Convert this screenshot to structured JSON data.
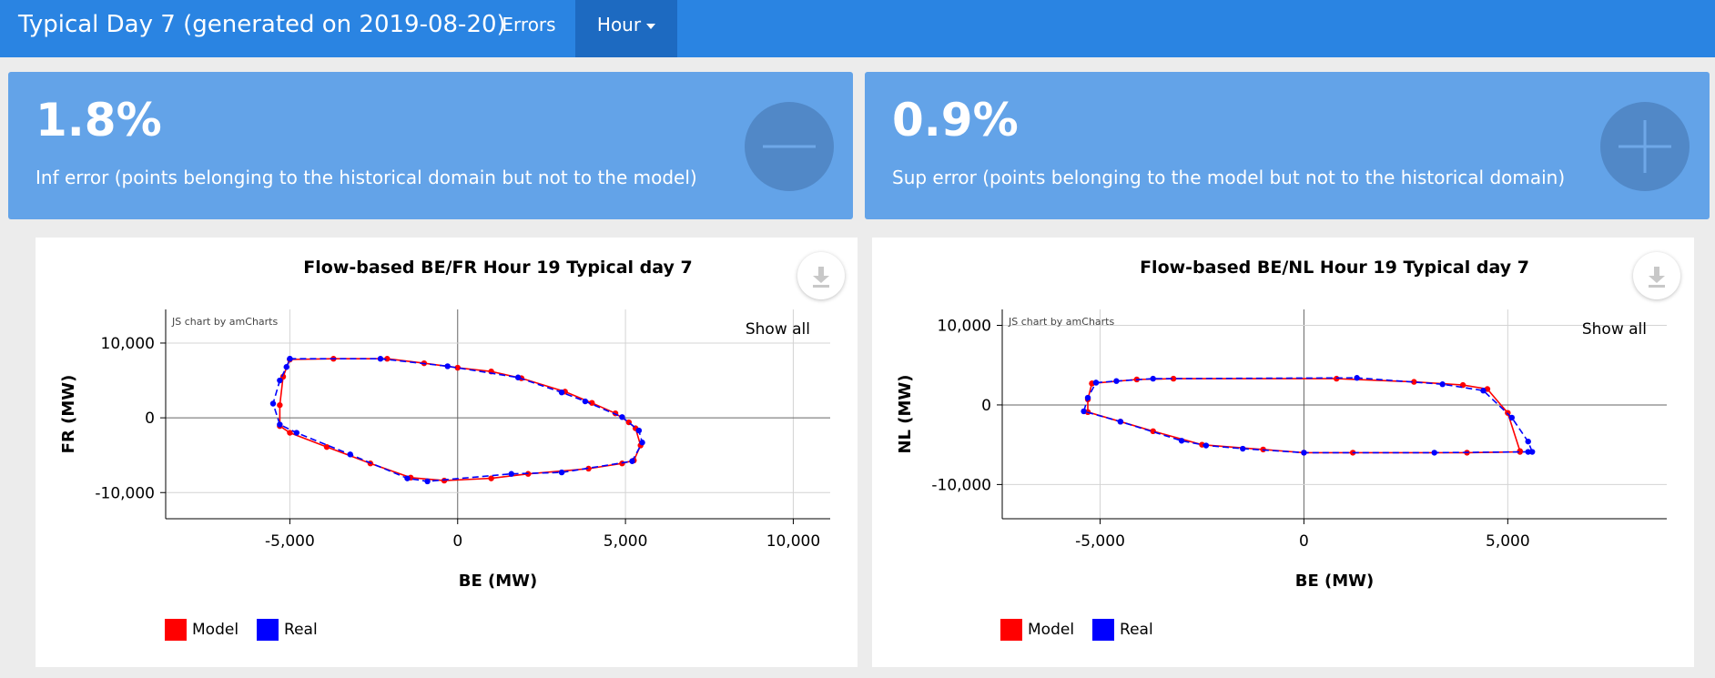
{
  "navbar": {
    "title": "Typical Day 7 (generated on 2019-08-20)",
    "errors_label": "Errors",
    "hour_label": "Hour"
  },
  "valueboxes": [
    {
      "value": "1.8%",
      "subtitle": "Inf error (points belonging to the historical domain but not to the model)",
      "icon": "minus-icon"
    },
    {
      "value": "0.9%",
      "subtitle": "Sup error (points belonging to the model but not to the historical domain)",
      "icon": "plus-icon"
    }
  ],
  "colors": {
    "navbar": "#2a84e2",
    "valuebox": "#63a3e8",
    "model": "#ff0000",
    "real": "#0000ff"
  },
  "common": {
    "credit": "JS chart by amCharts",
    "show_all": "Show all"
  },
  "chart_data": [
    {
      "type": "scatter",
      "title": "Flow-based BE/FR Hour 19 Typical day 7",
      "xlabel": "BE (MW)",
      "ylabel": "FR (MW)",
      "xlim": [
        -8700,
        11100
      ],
      "ylim": [
        -13500,
        14500
      ],
      "xticks": [
        -5000,
        0,
        5000,
        10000
      ],
      "yticks": [
        -10000,
        0,
        10000
      ],
      "xtick_labels": [
        "-5,000",
        "0",
        "5,000",
        "10,000"
      ],
      "ytick_labels": [
        "-10,000",
        "0",
        "10,000"
      ],
      "grid": true,
      "legend": {
        "position": "bottom-left",
        "items": [
          "Model",
          "Real"
        ]
      },
      "series": [
        {
          "name": "Model",
          "color": "#ff0000",
          "line": "solid",
          "x": [
            -5000,
            -3700,
            -2100,
            -1000,
            0,
            1000,
            1900,
            3200,
            4000,
            4700,
            5100,
            5300,
            5450,
            5250,
            4900,
            3900,
            2100,
            1000,
            -400,
            -1400,
            -2600,
            -3900,
            -5000,
            -5300,
            -5300,
            -5200,
            -5000
          ],
          "y": [
            7800,
            7900,
            7900,
            7300,
            6700,
            6200,
            5300,
            3500,
            2000,
            600,
            -600,
            -1400,
            -3700,
            -5700,
            -6100,
            -6800,
            -7500,
            -8100,
            -8400,
            -8000,
            -6100,
            -3900,
            -2000,
            -1100,
            1700,
            5500,
            7800
          ]
        },
        {
          "name": "Real",
          "color": "#0000ff",
          "line": "dashed",
          "x": [
            -5000,
            -2300,
            -300,
            1800,
            3100,
            3800,
            4900,
            5400,
            5500,
            5200,
            3100,
            1600,
            -900,
            -1500,
            -3200,
            -4800,
            -5300,
            -5500,
            -5300,
            -5100,
            -5000
          ],
          "y": [
            7900,
            7900,
            6900,
            5400,
            3400,
            2200,
            100,
            -1700,
            -3300,
            -5800,
            -7300,
            -7500,
            -8500,
            -8100,
            -4900,
            -2000,
            -900,
            1900,
            5000,
            6800,
            7900
          ]
        }
      ]
    },
    {
      "type": "scatter",
      "title": "Flow-based BE/NL Hour 19 Typical day 7",
      "xlabel": "BE (MW)",
      "ylabel": "NL (MW)",
      "xlim": [
        -7400,
        8900
      ],
      "ylim": [
        -14300,
        12000
      ],
      "xticks": [
        -5000,
        0,
        5000
      ],
      "yticks": [
        -10000,
        0,
        10000
      ],
      "xtick_labels": [
        "-5,000",
        "0",
        "5,000"
      ],
      "ytick_labels": [
        "-10,000",
        "0",
        "10,000"
      ],
      "grid": true,
      "legend": {
        "position": "bottom-left",
        "items": [
          "Model",
          "Real"
        ]
      },
      "series": [
        {
          "name": "Model",
          "color": "#ff0000",
          "line": "solid",
          "x": [
            -5200,
            -4100,
            -3200,
            800,
            2700,
            3900,
            4500,
            5000,
            5300,
            5300,
            4000,
            1200,
            0,
            -1000,
            -2500,
            -3700,
            -4500,
            -5300,
            -5300,
            -5200
          ],
          "y": [
            2700,
            3200,
            3300,
            3300,
            2900,
            2500,
            2000,
            -1000,
            -5800,
            -5900,
            -6000,
            -6000,
            -6000,
            -5600,
            -5000,
            -3300,
            -2100,
            -900,
            700,
            2700
          ]
        },
        {
          "name": "Real",
          "color": "#0000ff",
          "line": "dashed",
          "x": [
            -5100,
            -4600,
            -3700,
            1300,
            3400,
            4400,
            5100,
            5500,
            5600,
            5500,
            3200,
            0,
            -1500,
            -2400,
            -3000,
            -4500,
            -5400,
            -5300,
            -5100
          ],
          "y": [
            2800,
            3000,
            3300,
            3400,
            2600,
            1800,
            -1600,
            -4600,
            -5900,
            -5900,
            -6000,
            -6000,
            -5500,
            -5100,
            -4500,
            -2100,
            -800,
            900,
            2800
          ]
        }
      ]
    }
  ]
}
